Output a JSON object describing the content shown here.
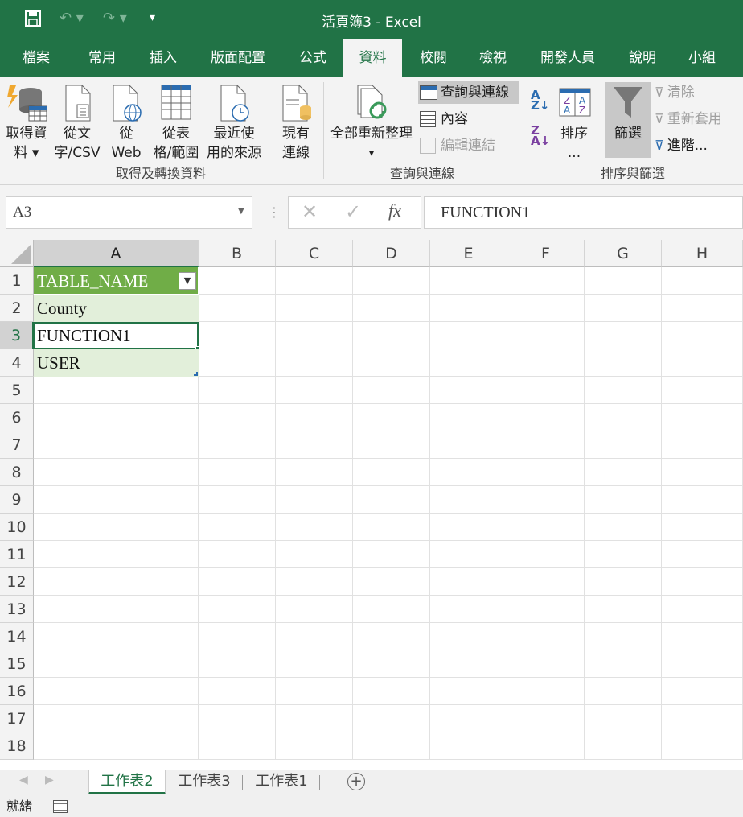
{
  "window": {
    "title": "活頁簿3  -  Excel"
  },
  "tabs": [
    "檔案",
    "常用",
    "插入",
    "版面配置",
    "公式",
    "資料",
    "校閱",
    "檢視",
    "開發人員",
    "說明",
    "小組"
  ],
  "ribbon": {
    "get_data": {
      "line1": "取得資",
      "line2": "料 ▾"
    },
    "from_text": {
      "line1": "從文",
      "line2": "字/CSV"
    },
    "from_web": {
      "line1": "從",
      "line2": "Web"
    },
    "from_table": {
      "line1": "從表",
      "line2": "格/範圍"
    },
    "recent": {
      "line1": "最近使",
      "line2": "用的來源"
    },
    "existing": {
      "line1": "現有",
      "line2": "連線"
    },
    "group1": "取得及轉換資料",
    "refresh_all": {
      "line1": "全部重新整理",
      "line2": "▾"
    },
    "queries": "查詢與連線",
    "properties": "內容",
    "edit_links": "編輯連結",
    "group2": "查詢與連線",
    "sort": {
      "line1": "排序",
      "line2": "..."
    },
    "filter": "篩選",
    "clear": "清除",
    "reapply": "重新套用",
    "advanced": "進階...",
    "group3": "排序與篩選"
  },
  "formula_bar": {
    "name_box": "A3",
    "formula": "FUNCTION1",
    "fx": "fx"
  },
  "columns": [
    "A",
    "B",
    "C",
    "D",
    "E",
    "F",
    "G",
    "H"
  ],
  "rows": [
    "1",
    "2",
    "3",
    "4",
    "5",
    "6",
    "7",
    "8",
    "9",
    "10",
    "11",
    "12",
    "13",
    "14",
    "15",
    "16",
    "17",
    "18"
  ],
  "cells": {
    "A1": "TABLE_NAME",
    "A2": "County",
    "A3": "FUNCTION1",
    "A4": "USER"
  },
  "sheets": [
    "工作表2",
    "工作表3",
    "工作表1"
  ],
  "status": {
    "text": "就緒"
  },
  "colors": {
    "brand": "#217346",
    "table_header": "#70ad47",
    "table_band": "#e2efda"
  }
}
